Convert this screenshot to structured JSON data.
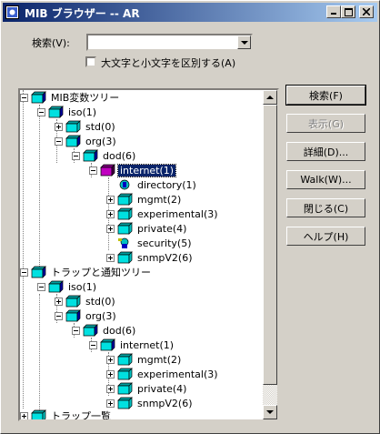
{
  "window": {
    "title": "MIB ブラウザー -- AR"
  },
  "search": {
    "label": "検索(V):",
    "value": "",
    "case_label": "大文字と小文字を区別する(A)",
    "case_checked": false
  },
  "buttons": {
    "search": "検索(F)",
    "display": "表示(G)",
    "details": "詳細(D)...",
    "walk": "Walk(W)...",
    "close": "閉じる(C)",
    "help": "ヘルプ(H)"
  },
  "tree": {
    "mib_root": "MIB変数ツリー",
    "iso": "iso(1)",
    "std": "std(0)",
    "org": "org(3)",
    "dod": "dod(6)",
    "internet": "internet(1)",
    "directory": "directory(1)",
    "mgmt": "mgmt(2)",
    "experimental": "experimental(3)",
    "private": "private(4)",
    "security": "security(5)",
    "snmpv2": "snmpV2(6)",
    "trap_root": "トラップと通知ツリー",
    "t_iso": "iso(1)",
    "t_std": "std(0)",
    "t_org": "org(3)",
    "t_dod": "dod(6)",
    "t_internet": "internet(1)",
    "t_mgmt": "mgmt(2)",
    "t_experimental": "experimental(3)",
    "t_private": "private(4)",
    "t_snmpv2": "snmpV2(6)",
    "trap_list": "トラップ一覧"
  },
  "colors": {
    "cube_cyan": "#00e0e0",
    "cube_blue": "#0000a0",
    "cube_selected": "#c000c0",
    "selection": "#0a246a"
  }
}
